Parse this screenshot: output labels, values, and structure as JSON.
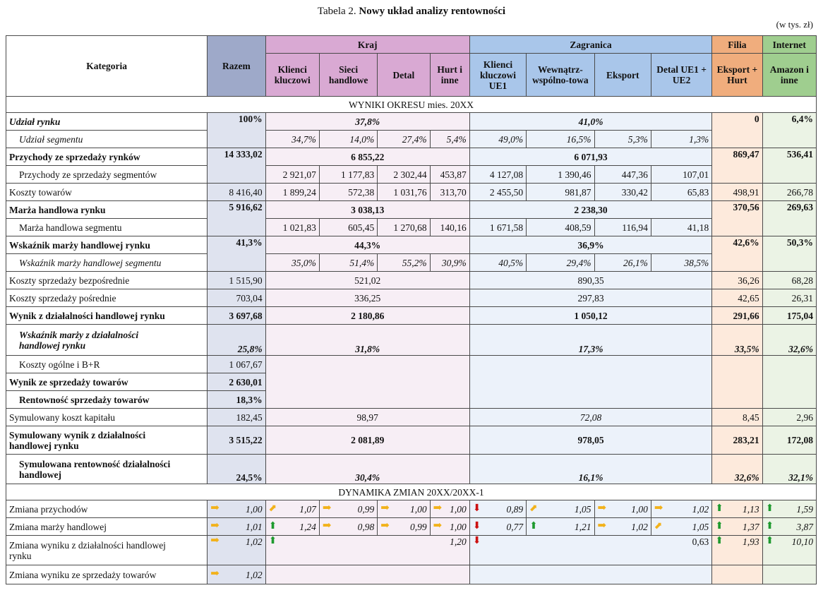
{
  "title_prefix": "Tabela 2.",
  "title_main": "Nowy układ analizy rentowności",
  "unit": "(w tys. zł)",
  "headers": {
    "kategoria": "Kategoria",
    "razem": "Razem",
    "kraj": "Kraj",
    "zagranica": "Zagranica",
    "filia": "Filia",
    "internet": "Internet",
    "k1": "Klienci kluczowi",
    "k2": "Sieci handlowe",
    "k3": "Detal",
    "k4": "Hurt i inne",
    "z1": "Klienci kluczowi UE1",
    "z2": "Wewnątrz-wspólno-towa",
    "z3": "Eksport",
    "z4": "Detal UE1 + UE2",
    "f1": "Eksport + Hurt",
    "i1": "Amazon i inne"
  },
  "section1": "WYNIKI OKRESU mies. 20XX",
  "section2": "DYNAMIKA ZMIAN 20XX/20XX-1",
  "rows": {
    "udzial_rynku": {
      "label": "Udział rynku",
      "razem": "100%",
      "kraj": "37,8%",
      "zag": "41,0%",
      "filia": "0",
      "internet": "6,4%"
    },
    "udzial_segmentu": {
      "label": "Udział segmentu",
      "k": [
        "34,7%",
        "14,0%",
        "27,4%",
        "5,4%"
      ],
      "z": [
        "49,0%",
        "16,5%",
        "5,3%",
        "1,3%"
      ]
    },
    "przychody_rynkow": {
      "label": "Przychody ze sprzedaży rynków",
      "razem": "14 333,02",
      "kraj": "6 855,22",
      "zag": "6 071,93",
      "filia": "869,47",
      "internet": "536,41"
    },
    "przychody_segmentow": {
      "label": "Przychody ze sprzedaży segmentów",
      "k": [
        "2 921,07",
        "1 177,83",
        "2 302,44",
        "453,87"
      ],
      "z": [
        "4 127,08",
        "1 390,46",
        "447,36",
        "107,01"
      ]
    },
    "koszty_towarow": {
      "label": "Koszty towarów",
      "razem": "8 416,40",
      "k": [
        "1 899,24",
        "572,38",
        "1 031,76",
        "313,70"
      ],
      "z": [
        "2 455,50",
        "981,87",
        "330,42",
        "65,83"
      ],
      "filia": "498,91",
      "internet": "266,78"
    },
    "marza_rynku": {
      "label": "Marża handlowa rynku",
      "razem": "5 916,62",
      "kraj": "3 038,13",
      "zag": "2 238,30",
      "filia": "370,56",
      "internet": "269,63"
    },
    "marza_segmentu": {
      "label": "Marża handlowa segmentu",
      "k": [
        "1 021,83",
        "605,45",
        "1 270,68",
        "140,16"
      ],
      "z": [
        "1 671,58",
        "408,59",
        "116,94",
        "41,18"
      ]
    },
    "wsk_marzy_rynku": {
      "label": "Wskaźnik marży handlowej rynku",
      "razem": "41,3%",
      "kraj": "44,3%",
      "zag": "36,9%",
      "filia": "42,6%",
      "internet": "50,3%"
    },
    "wsk_marzy_segmentu": {
      "label": "Wskaźnik marży handlowej segmentu",
      "k": [
        "35,0%",
        "51,4%",
        "55,2%",
        "30,9%"
      ],
      "z": [
        "40,5%",
        "29,4%",
        "26,1%",
        "38,5%"
      ]
    },
    "koszty_bezp": {
      "label": "Koszty sprzedaży bezpośrednie",
      "razem": "1 515,90",
      "kraj": "521,02",
      "zag": "890,35",
      "filia": "36,26",
      "internet": "68,28"
    },
    "koszty_posr": {
      "label": "Koszty sprzedaży pośrednie",
      "razem": "703,04",
      "kraj": "336,25",
      "zag": "297,83",
      "filia": "42,65",
      "internet": "26,31"
    },
    "wynik_dzial": {
      "label": "Wynik z działalności handlowej rynku",
      "razem": "3 697,68",
      "kraj": "2 180,86",
      "zag": "1 050,12",
      "filia": "291,66",
      "internet": "175,04"
    },
    "wsk_marzy_dzial": {
      "label1": "Wskaźnik marży z działalności",
      "label2": "handlowej rynku",
      "razem": "25,8%",
      "kraj": "31,8%",
      "zag": "17,3%",
      "filia": "33,5%",
      "internet": "32,6%"
    },
    "koszty_ogolne": {
      "label": "Koszty ogólne i B+R",
      "razem": "1 067,67"
    },
    "wynik_sprzedazy": {
      "label": "Wynik ze sprzedaży towarów",
      "razem": "2 630,01"
    },
    "rentownosc": {
      "label": "Rentowność sprzedaży towarów",
      "razem": "18,3%"
    },
    "symul_koszt": {
      "label": "Symulowany koszt kapitału",
      "razem": "182,45",
      "kraj": "98,97",
      "zag": "72,08",
      "filia": "8,45",
      "internet": "2,96"
    },
    "symul_wynik": {
      "label1": "Symulowany wynik z działalności",
      "label2": "handlowej rynku",
      "razem": "3 515,22",
      "kraj": "2 081,89",
      "zag": "978,05",
      "filia": "283,21",
      "internet": "172,08"
    },
    "symul_rent": {
      "label1": "Symulowana rentowność działalności",
      "label2": "handlowej",
      "razem": "24,5%",
      "kraj": "30,4%",
      "zag": "16,1%",
      "filia": "32,6%",
      "internet": "32,1%"
    },
    "zm_przychodow": {
      "label": "Zmiana przychodów",
      "razem": "1,00",
      "k": [
        "1,07",
        "0,99",
        "1,00",
        "1,00"
      ],
      "z": [
        "0,89",
        "1,05",
        "1,00",
        "1,02"
      ],
      "filia": "1,13",
      "internet": "1,59"
    },
    "zm_marzy": {
      "label": "Zmiana marży handlowej",
      "razem": "1,01",
      "k": [
        "1,24",
        "0,98",
        "0,99",
        "1,00"
      ],
      "z": [
        "0,77",
        "1,21",
        "1,02",
        "1,05"
      ],
      "filia": "1,37",
      "internet": "3,87"
    },
    "zm_wyniku_dzial": {
      "label1": "Zmiana wyniku z działalności handlowej",
      "label2": "rynku",
      "razem": "1,02",
      "kraj": "1,20",
      "zag": "0,63",
      "filia": "1,93",
      "internet": "10,10"
    },
    "zm_wyniku_sprz": {
      "label": "Zmiana wyniku ze sprzedaży towarów",
      "razem": "1,02"
    }
  },
  "colors": {
    "kraj": "#d9a9d3",
    "zagranica": "#a9c6ea",
    "filia": "#f0ad7d",
    "internet": "#9fce8f",
    "razem": "#9ea9c9",
    "arrow_up": "#1f9a2f",
    "arrow_down": "#cc1111",
    "arrow_side": "#f2b21b"
  },
  "icons": {
    "up": "arrow-up-icon",
    "down": "arrow-down-icon",
    "right": "arrow-right-icon",
    "diag": "arrow-diagonal-icon"
  }
}
